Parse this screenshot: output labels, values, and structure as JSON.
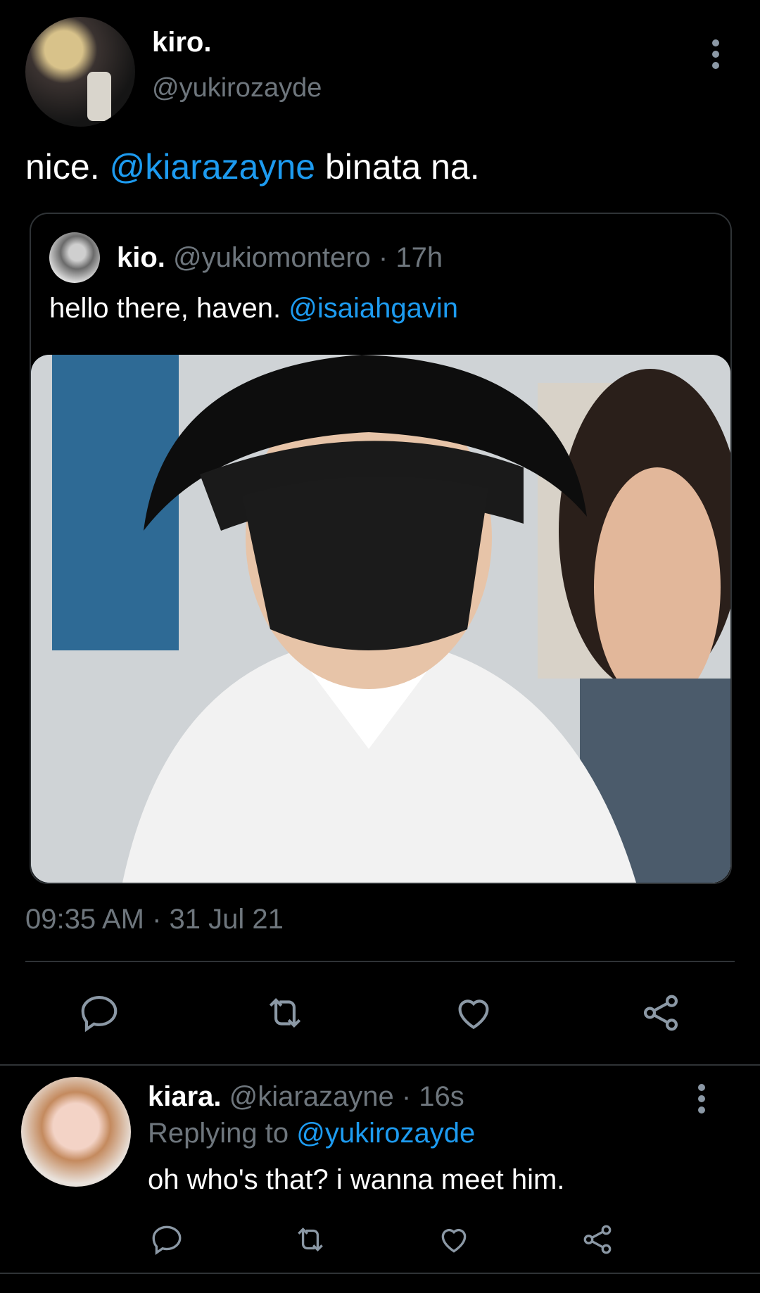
{
  "main_tweet": {
    "name": "kiro.",
    "handle": "@yukirozayde",
    "text_before": "nice. ",
    "mention": "@kiarazayne",
    "text_after": " binata na.",
    "timestamp": "09:35 AM · 31 Jul 21"
  },
  "quoted_tweet": {
    "name": "kio.",
    "handle": "@yukiomontero",
    "time": "· 17h",
    "text": "hello there, haven. ",
    "mention": "@isaiahgavin"
  },
  "reply": {
    "name": "kiara.",
    "handle": "@kiarazayne",
    "time": "· 16s",
    "replying_label": "Replying to ",
    "replying_handle": "@yukirozayde",
    "text": "oh who's that? i wanna meet him."
  },
  "icons": [
    "reply-icon",
    "retweet-icon",
    "like-icon",
    "share-icon",
    "more-icon"
  ],
  "colors": {
    "background": "#000000",
    "muted": "#6e767d",
    "link": "#1d9bf0",
    "divider": "#2f3336"
  }
}
